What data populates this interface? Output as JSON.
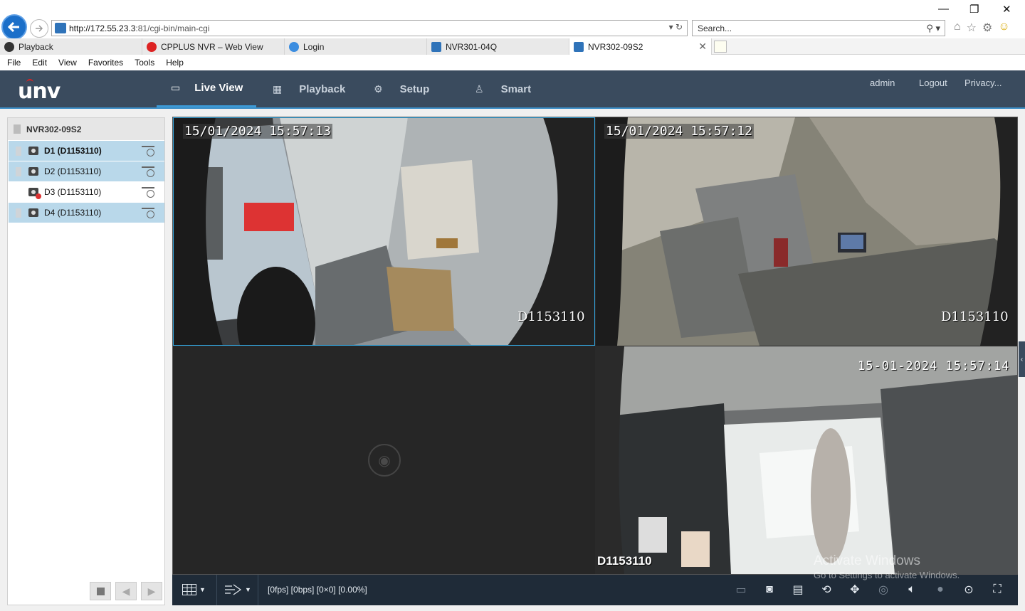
{
  "browser": {
    "url_host": "http://172.55.23.3",
    "url_path": ":81/cgi-bin/main-cgi",
    "search_placeholder": "Search...",
    "tabs": [
      {
        "label": "Playback"
      },
      {
        "label": "CPPLUS NVR – Web View"
      },
      {
        "label": "Login"
      },
      {
        "label": "NVR301-04Q"
      },
      {
        "label": "NVR302-09S2"
      }
    ],
    "menu": [
      "File",
      "Edit",
      "View",
      "Favorites",
      "Tools",
      "Help"
    ]
  },
  "app": {
    "logo": "unv",
    "nav": [
      {
        "label": "Live View",
        "icon": "monitor-icon"
      },
      {
        "label": "Playback",
        "icon": "film-icon"
      },
      {
        "label": "Setup",
        "icon": "gear-icon"
      },
      {
        "label": "Smart",
        "icon": "person-icon"
      }
    ],
    "header_links": {
      "user": "admin",
      "logout": "Logout",
      "privacy": "Privacy..."
    }
  },
  "device_tree": {
    "root": "NVR302-09S2",
    "cameras": [
      {
        "label": "D1 (D1153110)"
      },
      {
        "label": "D2 (D1153110)"
      },
      {
        "label": "D3 (D1153110)"
      },
      {
        "label": "D4 (D1153110)"
      }
    ]
  },
  "panes": {
    "p1": {
      "timestamp": "15/01/2024 15:57:13",
      "id": "D1153110"
    },
    "p2": {
      "timestamp": "15/01/2024 15:57:12",
      "id": "D1153110"
    },
    "p4": {
      "timestamp": "15-01-2024 15:57:14",
      "id": "D1153110"
    }
  },
  "toolbar": {
    "stats": "[0fps] [0bps] [0×0] [0.00%]"
  },
  "watermark": {
    "line1": "Activate Windows",
    "line2": "Go to Settings to activate Windows."
  },
  "colors": {
    "header_bg": "#3a4b5e",
    "accent": "#3d9ad6",
    "selected_row": "#b9d8ea"
  }
}
